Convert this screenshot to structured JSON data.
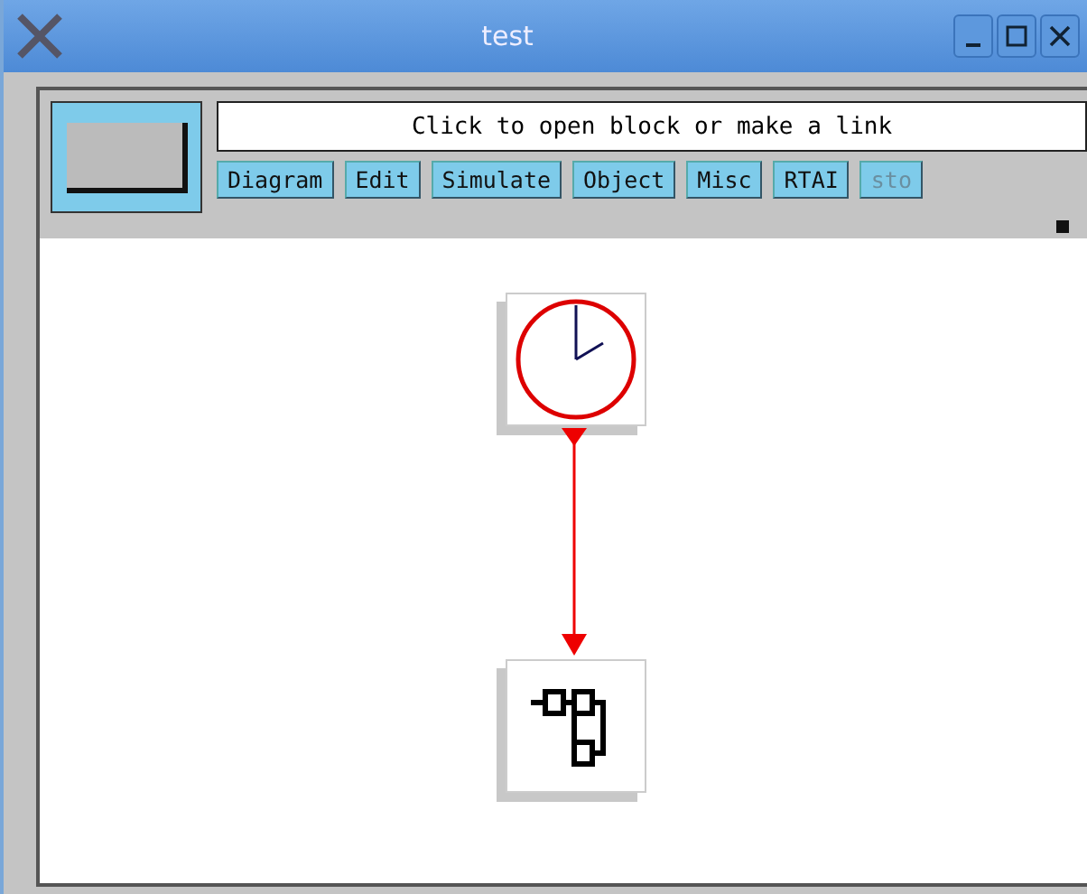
{
  "window": {
    "title": "test"
  },
  "message": "Click to open block or make a link",
  "menu": [
    {
      "label": "Diagram",
      "disabled": false
    },
    {
      "label": "Edit",
      "disabled": false
    },
    {
      "label": "Simulate",
      "disabled": false
    },
    {
      "label": "Object",
      "disabled": false
    },
    {
      "label": "Misc",
      "disabled": false
    },
    {
      "label": "RTAI",
      "disabled": false
    },
    {
      "label": "sto",
      "disabled": true
    }
  ],
  "diagram": {
    "blocks": [
      {
        "kind": "clock"
      },
      {
        "kind": "scope"
      }
    ]
  }
}
